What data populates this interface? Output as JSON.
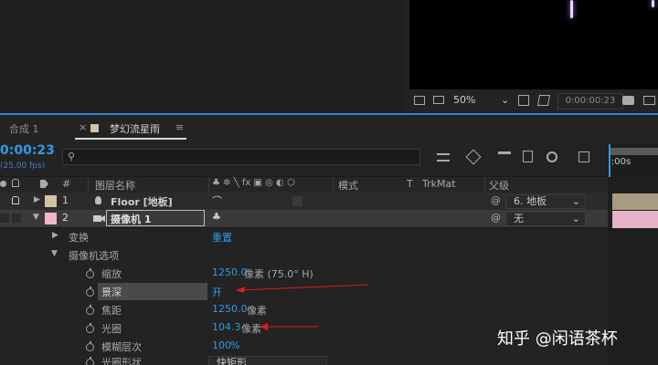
{
  "viewer": {
    "zoom": "50%",
    "timecode": "0:00:00:23"
  },
  "tabs": {
    "comp1": "合成 1",
    "active": "梦幻流星雨",
    "menu": "≡",
    "close": "×"
  },
  "timeline": {
    "current_time": "0:00:23",
    "fps": "(25.00 fps)",
    "search_placeholder": "",
    "ruler_label": "):00s"
  },
  "columns": {
    "hash": "#",
    "layer_name": "图层名称",
    "switches": "♣ ✲ ╲ fx ▣ ◎ ◐ ⬡",
    "mode": "模式",
    "t": "T",
    "trkmat": "TrkMat",
    "parent": "父级"
  },
  "layers": [
    {
      "index": "1",
      "name": "Floor [地板]",
      "switch": "⌒",
      "parent": "6. 地板"
    },
    {
      "index": "2",
      "name": "摄像机 1",
      "switch": "♣",
      "parent": "无"
    }
  ],
  "transform": {
    "label": "变换",
    "reset": "重置"
  },
  "camera_options": {
    "label": "摄像机选项",
    "props": [
      {
        "name": "缩放",
        "value": "1250.0",
        "unit": "像素 (75.0° H)"
      },
      {
        "name": "景深",
        "value": "开",
        "unit": ""
      },
      {
        "name": "焦距",
        "value": "1250.0",
        "unit": "像素"
      },
      {
        "name": "光圈",
        "value": "104.3",
        "unit": "像素"
      },
      {
        "name": "模糊层次",
        "value": "100",
        "unit": "%"
      },
      {
        "name": "光圈形状",
        "value": "快矩形",
        "unit": ""
      }
    ]
  },
  "watermark": "知乎 @闲语茶杯",
  "colors": {
    "accent": "#2e9be6",
    "selected_label": "#f0b6c8",
    "floor_label": "#d6c3a3",
    "annotation": "#d81e1e"
  }
}
